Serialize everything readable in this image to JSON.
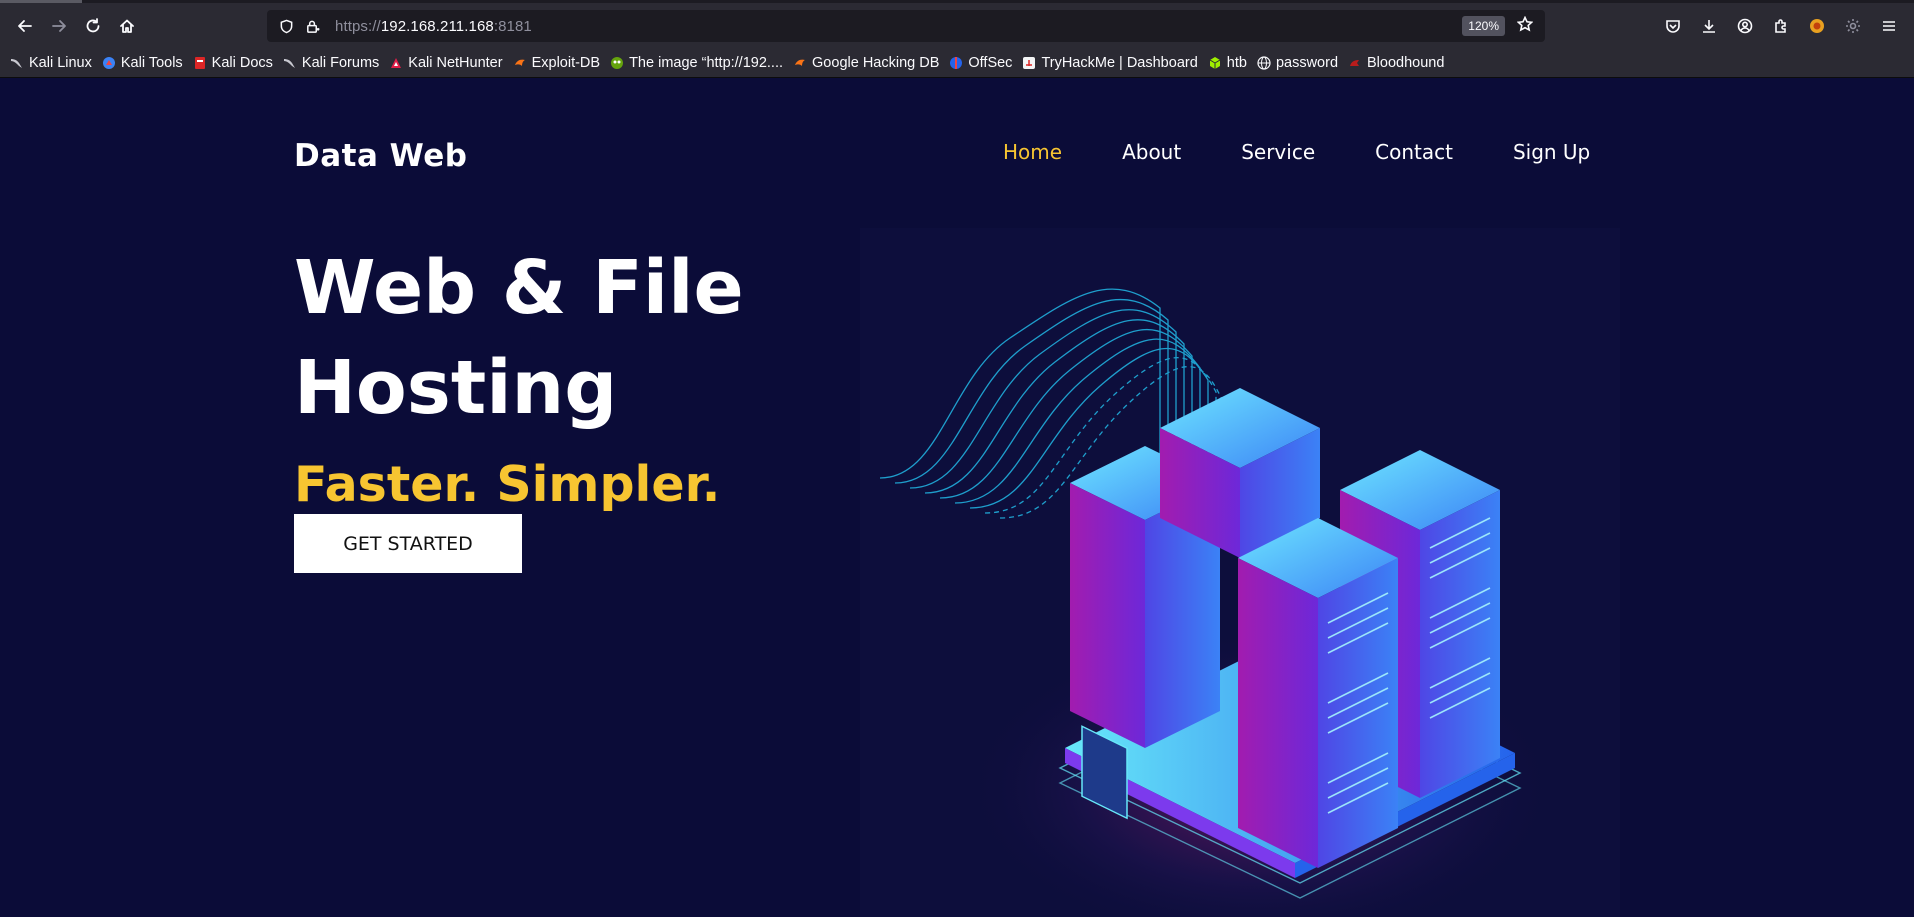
{
  "browser": {
    "url_scheme": "https://",
    "url_host": "192.168.211.168",
    "url_port": ":8181",
    "zoom": "120%",
    "bookmarks": [
      {
        "label": "Kali Linux",
        "icon": "kali-dragon-icon"
      },
      {
        "label": "Kali Tools",
        "icon": "kali-tools-icon"
      },
      {
        "label": "Kali Docs",
        "icon": "kali-docs-icon"
      },
      {
        "label": "Kali Forums",
        "icon": "kali-dragon-icon"
      },
      {
        "label": "Kali NetHunter",
        "icon": "nethunter-icon"
      },
      {
        "label": "Exploit-DB",
        "icon": "exploit-db-icon"
      },
      {
        "label": "The image “http://192....",
        "icon": "image-icon"
      },
      {
        "label": "Google Hacking DB",
        "icon": "exploit-db-icon"
      },
      {
        "label": "OffSec",
        "icon": "offsec-icon"
      },
      {
        "label": "TryHackMe | Dashboard",
        "icon": "tryhackme-icon"
      },
      {
        "label": "htb",
        "icon": "htb-cube-icon"
      },
      {
        "label": "password",
        "icon": "globe-icon"
      },
      {
        "label": "Bloodhound",
        "icon": "bloodhound-icon"
      }
    ]
  },
  "site": {
    "logo": "Data Web",
    "nav": [
      "Home",
      "About",
      "Service",
      "Contact",
      "Sign Up"
    ],
    "hero_line1": "Web & File",
    "hero_line2": "Hosting",
    "tagline": "Faster. Simpler.",
    "cta": "GET STARTED"
  },
  "colors": {
    "background": "#0b0c38",
    "accent": "#f7c531",
    "toolbar": "#2b2a33"
  }
}
